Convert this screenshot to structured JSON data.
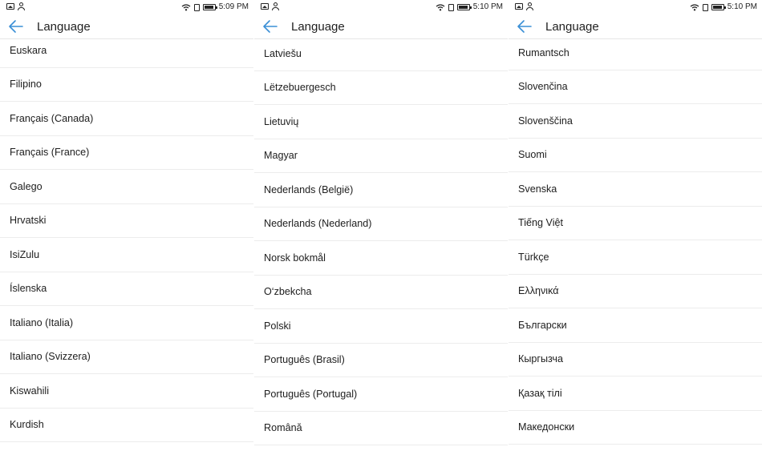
{
  "screens": [
    {
      "status": {
        "time": "5:09 PM"
      },
      "header": {
        "title": "Language"
      },
      "languages": [
        "Euskara",
        "Filipino",
        "Français (Canada)",
        "Français (France)",
        "Galego",
        "Hrvatski",
        "IsiZulu",
        "Íslenska",
        "Italiano (Italia)",
        "Italiano (Svizzera)",
        "Kiswahili",
        "Kurdish"
      ]
    },
    {
      "status": {
        "time": "5:10 PM"
      },
      "header": {
        "title": "Language"
      },
      "languages": [
        "Latviešu",
        "Lëtzebuergesch",
        "Lietuvių",
        "Magyar",
        "Nederlands (België)",
        "Nederlands (Nederland)",
        "Norsk bokmål",
        "O‘zbekcha",
        "Polski",
        "Português (Brasil)",
        "Português (Portugal)",
        "Română"
      ]
    },
    {
      "status": {
        "time": "5:10 PM"
      },
      "header": {
        "title": "Language"
      },
      "languages": [
        "Rumantsch",
        "Slovenčina",
        "Slovenščina",
        "Suomi",
        "Svenska",
        "Tiếng Việt",
        "Türkçe",
        "Ελληνικά",
        "Български",
        "Кыргызча",
        "Қазақ тілі",
        "Македонски"
      ]
    }
  ],
  "colors": {
    "accent": "#3a8fd6",
    "divider": "#ececec",
    "text": "#1f1f1f"
  },
  "icons": [
    "image-icon",
    "user-icon",
    "wifi-icon",
    "sim-icon",
    "battery-icon",
    "back-arrow-icon"
  ]
}
